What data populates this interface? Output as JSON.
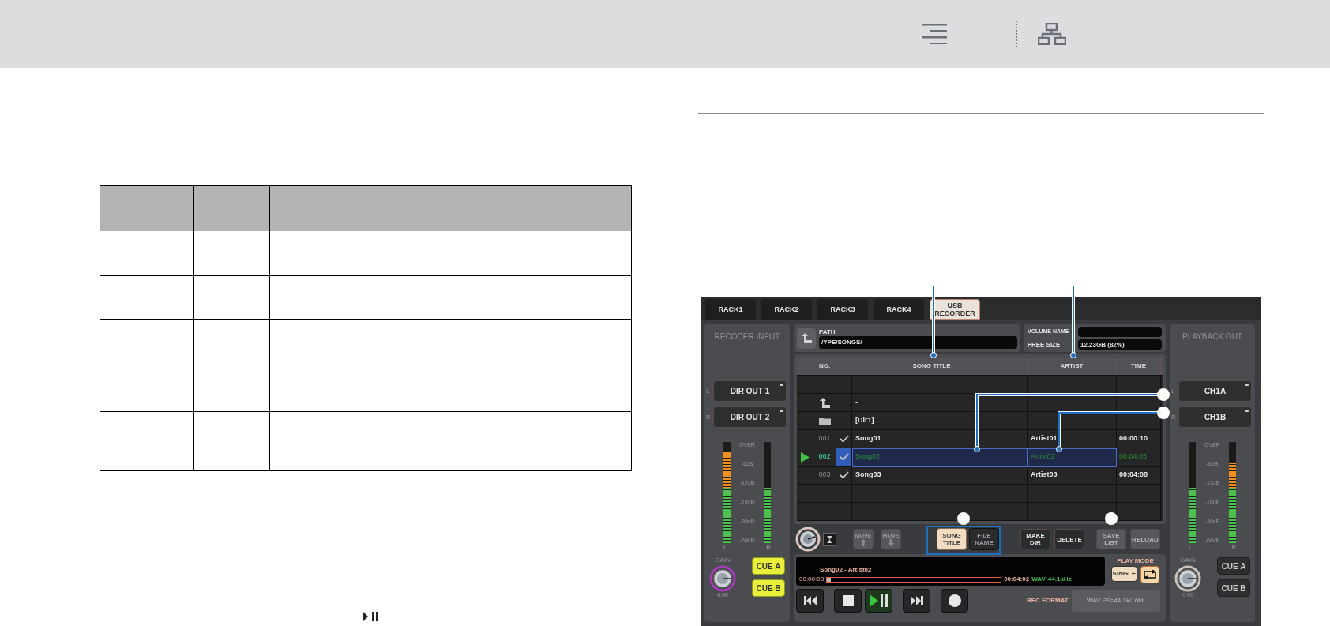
{
  "mixer": {
    "tabs": [
      {
        "label": "RACK1",
        "selected": false
      },
      {
        "label": "RACK2",
        "selected": false
      },
      {
        "label": "RACK3",
        "selected": false
      },
      {
        "label": "RACK4",
        "selected": false
      },
      {
        "label": "USB RECORDER",
        "selected": true
      }
    ],
    "input": {
      "title": "RECODER INPUT",
      "outputs": [
        {
          "side": "L",
          "label": "DIR OUT 1"
        },
        {
          "side": "R",
          "label": "DIR OUT 2"
        }
      ],
      "meter": {
        "scale": [
          "OVER",
          "-6dB",
          "-12dB",
          "-18dB",
          "-30dB",
          "-60dB"
        ],
        "channels": [
          {
            "label": "L",
            "level": 0.9
          },
          {
            "label": "R",
            "level": 0.55
          }
        ]
      },
      "gain": {
        "label": "GAIN",
        "value": "0.00"
      },
      "cues": [
        {
          "label": "CUE A",
          "on": true
        },
        {
          "label": "CUE B",
          "on": true
        }
      ]
    },
    "path": {
      "label": "PATH",
      "value": "/YPE/SONGS/"
    },
    "volume": {
      "name_label": "VOLUME NAME",
      "size_label": "FREE SIZE",
      "size": "12.23GB (82%)"
    },
    "list": {
      "columns": [
        "NO.",
        "SONG TITLE",
        "ARTIST",
        "TIME"
      ],
      "rows": [
        {
          "kind": "empty"
        },
        {
          "kind": "parent",
          "title": "-"
        },
        {
          "kind": "folder",
          "title": "[Dir1]"
        },
        {
          "kind": "song",
          "no": "001",
          "checked": true,
          "title": "Song01",
          "artist": "Artist01",
          "time": "00:00:10",
          "selected": false
        },
        {
          "kind": "song",
          "no": "002",
          "checked": true,
          "title": "Song02",
          "artist": "Artist02",
          "time": "00:04:05",
          "selected": true
        },
        {
          "kind": "song",
          "no": "003",
          "checked": true,
          "title": "Song03",
          "artist": "Artist03",
          "time": "00:04:08",
          "selected": false
        },
        {
          "kind": "empty"
        },
        {
          "kind": "empty"
        }
      ]
    },
    "controls": {
      "move": [
        {
          "label": "MOVE",
          "kind": "up",
          "disabled": true
        },
        {
          "label": "MOVE",
          "kind": "down",
          "disabled": true
        }
      ],
      "name_mode": [
        {
          "label": "SONG TITLE",
          "selected": true
        },
        {
          "label": "FILE NAME",
          "selected": false
        }
      ],
      "actions": [
        {
          "label": "MAKE DIR",
          "disabled": false
        },
        {
          "label": "DELETE",
          "disabled": false
        },
        {
          "label": "SAVE LIST",
          "disabled": true
        },
        {
          "label": "RELOAD",
          "disabled": true
        }
      ]
    },
    "display": {
      "song": "Song02 - Artist02",
      "elapsed": "00:00:03",
      "progress": {
        "level": 0.02
      },
      "total": "00:04:02",
      "format": "WAV",
      "rate": "44.1kHz"
    },
    "play_mode": {
      "label": "PLAY MODE",
      "single": {
        "label": "SINGLE",
        "on": true
      },
      "repeat": {
        "on": true
      }
    },
    "transport": [
      {
        "kind": "prev",
        "on": false
      },
      {
        "kind": "stop",
        "on": false
      },
      {
        "kind": "play",
        "on": true
      },
      {
        "kind": "next",
        "on": false
      },
      {
        "kind": "rec",
        "on": false
      }
    ],
    "rec_format": {
      "label": "REC FORMAT",
      "value": "WAV FS=44.1k/16bit",
      "disabled": true
    },
    "playback": {
      "title": "PLAYBACK OUT",
      "outputs": [
        {
          "side": "L",
          "label": "CH1A"
        },
        {
          "side": "R",
          "label": "CH1B"
        }
      ],
      "meter": {
        "scale": [
          "OVER",
          "-6dB",
          "-12dB",
          "-18dB",
          "-30dB",
          "-60dB"
        ],
        "channels": [
          {
            "label": "L",
            "level": 0.55
          },
          {
            "label": "R",
            "level": 0.8
          }
        ]
      },
      "gain": {
        "label": "GAIN",
        "value": "0.00"
      },
      "cues": [
        {
          "label": "CUE A",
          "on": false
        },
        {
          "label": "CUE B",
          "on": false
        }
      ]
    }
  }
}
